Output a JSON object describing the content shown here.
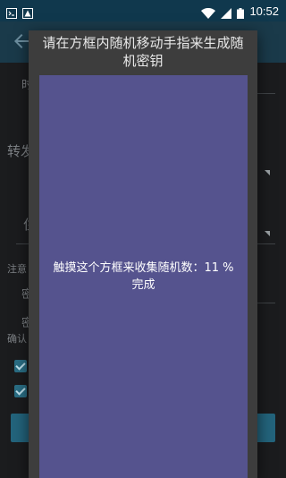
{
  "status_bar": {
    "time": "10:52",
    "icons": [
      "terminal-icon",
      "alert-icon",
      "wifi-icon",
      "signal-icon",
      "battery-icon"
    ]
  },
  "background_form": {
    "items_partial": [
      "时",
      "转发",
      "住",
      "注意",
      "密",
      "密",
      "确认"
    ]
  },
  "dialog": {
    "title": "请在方框内随机移动手指来生成随机密钥",
    "instruction": "触摸这个方框来收集随机数：11 % 完成",
    "progress_percent": 11
  },
  "colors": {
    "status_bar": "#10384d",
    "dialog_bg": "#3d3d3d",
    "touch_area": "#55538e",
    "accent": "#2a6f86"
  }
}
